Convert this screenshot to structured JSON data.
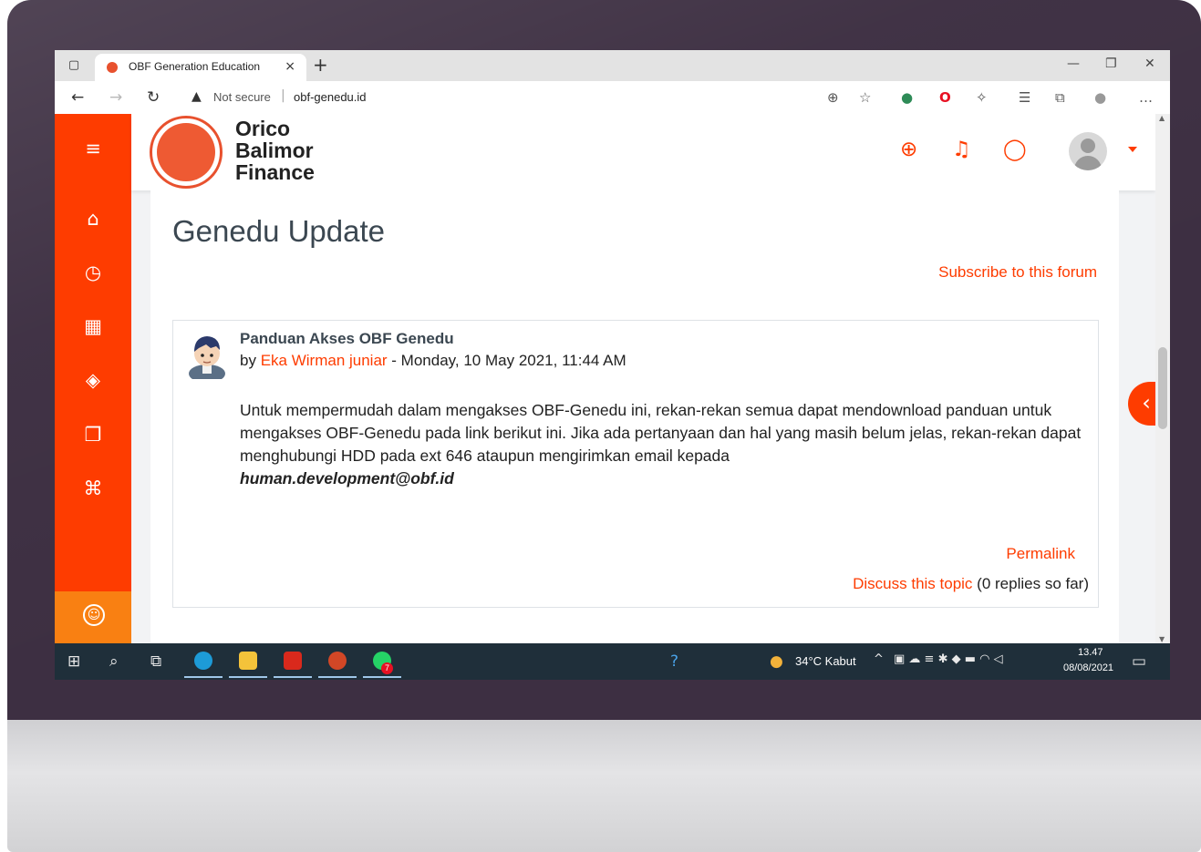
{
  "browser": {
    "tab_title": "OBF Generation Education",
    "tab_close": "×",
    "new_tab": "+",
    "security_label": "Not secure",
    "url": "obf-genedu.id"
  },
  "brand": {
    "line1": "Orico",
    "line2": "Balimor",
    "line3": "Finance",
    "accent_color": "#fe3c00",
    "secondary_color": "#f98012"
  },
  "sidebar": {
    "items": [
      "menu-icon",
      "home-icon",
      "dashboard-icon",
      "calendar-icon",
      "layers-icon",
      "files-icon",
      "courses-icon"
    ],
    "bottom": "accessibility-icon"
  },
  "header": {
    "icons": [
      "language-icon",
      "bell-icon",
      "message-icon",
      "avatar"
    ]
  },
  "forum": {
    "title": "Genedu Update",
    "subscribe": "Subscribe to this forum"
  },
  "post": {
    "subject": "Panduan Akses OBF Genedu",
    "by": "by",
    "author": "Eka Wirman juniar",
    "date": " - Monday, 10 May 2021, 11:44 AM",
    "body": "Untuk mempermudah dalam mengakses OBF-Genedu ini, rekan-rekan semua dapat mendownload panduan untuk mengakses OBF-Genedu pada link berikut ini. Jika ada pertanyaan dan hal yang masih belum jelas, rekan-rekan dapat menghubungi HDD pada ext 646 ataupun mengirimkan email kepada",
    "email": "human.development@obf.id",
    "permalink": "Permalink",
    "discuss": "Discuss this topic",
    "replies": "(0 replies so far)"
  },
  "taskbar": {
    "weather": "34°C Kabut",
    "time": "13.47",
    "date": "08/08/2021",
    "whatsapp_badge": "7"
  }
}
